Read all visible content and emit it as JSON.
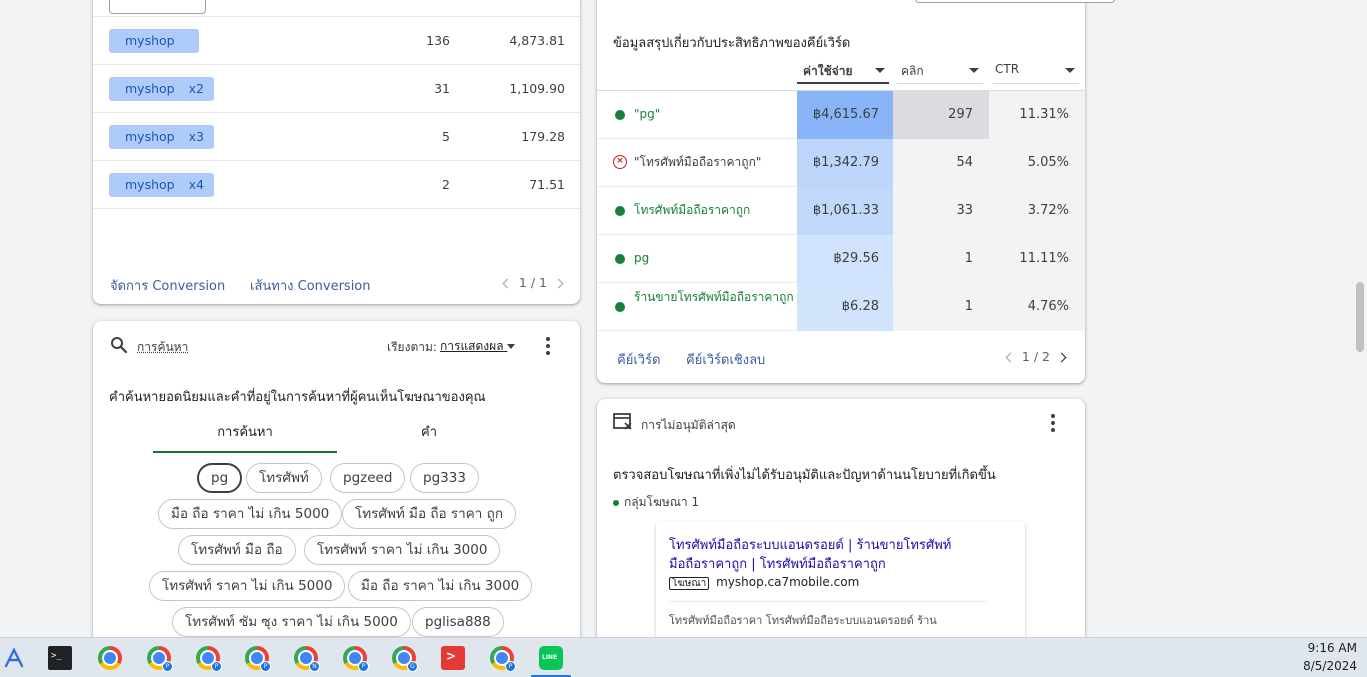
{
  "conversion_card": {
    "rows": [
      {
        "chip": "myshop",
        "mult": "",
        "count": "136",
        "value": "4,873.81"
      },
      {
        "chip": "myshop",
        "mult": "x2",
        "count": "31",
        "value": "1,109.90"
      },
      {
        "chip": "myshop",
        "mult": "x3",
        "count": "5",
        "value": "179.28"
      },
      {
        "chip": "myshop",
        "mult": "x4",
        "count": "2",
        "value": "71.51"
      }
    ],
    "manage_link": "จัดการ Conversion",
    "path_link": "เส้นทาง Conversion",
    "pagination": "1 / 1"
  },
  "search_card": {
    "header": "การค้นหา",
    "sort_label": "เรียงตาม:",
    "sort_value": "การแสดงผล",
    "description": "คำค้นหายอดนิยมและคำที่อยู่ในการค้นหาที่ผู้คนเห็นโฆษณาของคุณ",
    "tabs": [
      "การค้นหา",
      "คำ"
    ],
    "tags": [
      "pg",
      "โทรศัพท์",
      "pgzeed",
      "pg333",
      "มือ ถือ ราคา ไม่ เกิน 5000",
      "โทรศัพท์ มือ ถือ ราคา ถูก",
      "โทรศัพท์ มือ ถือ",
      "โทรศัพท์ ราคา ไม่ เกิน 3000",
      "โทรศัพท์ ราคา ไม่ เกิน 5000",
      "มือ ถือ ราคา ไม่ เกิน 3000",
      "โทรศัพท์ ซัม ซุง ราคา ไม่ เกิน 5000",
      "pglisa888"
    ]
  },
  "keyword_card": {
    "title": "ข้อมูลสรุปเกี่ยวกับประสิทธิภาพของคีย์เวิร์ด",
    "columns": [
      "ค่าใช้จ่าย",
      "คลิก",
      "CTR"
    ],
    "rows": [
      {
        "keyword": "\"pg\"",
        "status": "eligible",
        "cost": "฿4,615.67",
        "clicks": "297",
        "ctr": "11.31%",
        "cost_share": 1.0
      },
      {
        "keyword": "\"โทรศัพท์มือถือราคาถูก\"",
        "status": "disapproved",
        "cost": "฿1,342.79",
        "clicks": "54",
        "ctr": "5.05%",
        "cost_share": 0.29
      },
      {
        "keyword": "โทรศัพท์มือถือราคาถูก",
        "status": "eligible",
        "cost": "฿1,061.33",
        "clicks": "33",
        "ctr": "3.72%",
        "cost_share": 0.23
      },
      {
        "keyword": "pg",
        "status": "eligible",
        "cost": "฿29.56",
        "clicks": "1",
        "ctr": "11.11%",
        "cost_share": 0.01
      },
      {
        "keyword": "ร้านขายโทรศัพท์มือถือราคาถูก",
        "status": "eligible",
        "cost": "฿6.28",
        "clicks": "1",
        "ctr": "4.76%",
        "cost_share": 0.0
      }
    ],
    "keywords_link": "คีย์เวิร์ด",
    "negative_link": "คีย์เวิร์ดเชิงลบ",
    "pagination": "1 / 2",
    "colors": {
      "cost_max": "#8ab4f8",
      "cost_min": "#d2e3fc",
      "clicks_max": "#dadce0",
      "clicks_bg": "#f1f3f4"
    }
  },
  "disapproval_card": {
    "header": "การไม่อนุมัติล่าสุด",
    "title": "ตรวจสอบโฆษณาที่เพิ่งไม่ได้รับอนุมัติและปัญหาด้านนโยบายที่เกิดขึ้น",
    "group": "กลุ่มโฆษณา 1",
    "ad_headline_1": "โทรศัพท์มือถือระบบแอนดรอยด์ | ร้านขายโทรศัพท์",
    "ad_headline_2": "มือถือราคาถูก | โทรศัพท์มือถือราคาถูก",
    "ad_badge": "โฆษณา",
    "ad_url": "myshop.ca7mobile.com",
    "ad_description": "โทรศัพท์มือถือราคา โทรศัพท์มือถือระบบแอนดรอยด์ ร้าน"
  },
  "taskbar": {
    "time": "9:16 AM",
    "date": "8/5/2024"
  }
}
